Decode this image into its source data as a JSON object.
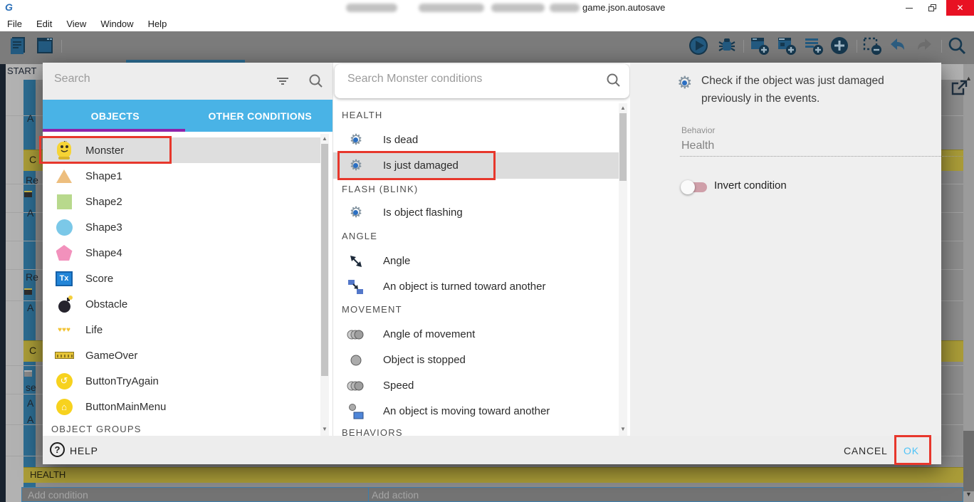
{
  "window": {
    "title_suffix": "game.json.autosave",
    "controls": {
      "close": "✕"
    }
  },
  "menu": {
    "items": [
      "File",
      "Edit",
      "View",
      "Window",
      "Help"
    ]
  },
  "toolbar": {
    "left_icons": [
      "project-manager",
      "scene-window"
    ],
    "right_icons": [
      "play",
      "debug",
      "add-event",
      "add-subevent",
      "add-comment",
      "add-circle",
      "remove-selection",
      "undo",
      "redo",
      "search"
    ]
  },
  "dialog": {
    "left_panel": {
      "search_placeholder": "Search",
      "tabs": [
        {
          "label": "OBJECTS",
          "active": true
        },
        {
          "label": "OTHER CONDITIONS",
          "active": false
        }
      ],
      "objects": [
        {
          "name": "Monster",
          "icon": "monster",
          "selected": true
        },
        {
          "name": "Shape1",
          "icon": "triangle",
          "selected": false
        },
        {
          "name": "Shape2",
          "icon": "square",
          "selected": false
        },
        {
          "name": "Shape3",
          "icon": "circle",
          "selected": false
        },
        {
          "name": "Shape4",
          "icon": "pentagon",
          "selected": false
        },
        {
          "name": "Score",
          "icon": "text-object",
          "selected": false
        },
        {
          "name": "Obstacle",
          "icon": "bomb",
          "selected": false
        },
        {
          "name": "Life",
          "icon": "hearts",
          "selected": false
        },
        {
          "name": "GameOver",
          "icon": "banner",
          "selected": false
        },
        {
          "name": "ButtonTryAgain",
          "icon": "retry-button",
          "selected": false
        },
        {
          "name": "ButtonMainMenu",
          "icon": "home-button",
          "selected": false
        }
      ],
      "score_icon_text": "Tx",
      "hearts_icon_text": "♥♥♥",
      "retry_glyph": "↺",
      "home_glyph": "⌂",
      "groups_header": "OBJECT GROUPS"
    },
    "middle_panel": {
      "search_placeholder": "Search Monster conditions",
      "sections": [
        {
          "header": "HEALTH",
          "items": [
            {
              "label": "Is dead",
              "icon": "gear",
              "selected": false
            },
            {
              "label": "Is just damaged",
              "icon": "gear",
              "selected": true
            }
          ]
        },
        {
          "header": "FLASH (BLINK)",
          "items": [
            {
              "label": "Is object flashing",
              "icon": "gear",
              "selected": false
            }
          ]
        },
        {
          "header": "ANGLE",
          "items": [
            {
              "label": "Angle",
              "icon": "diagonal-arrow",
              "selected": false
            },
            {
              "label": "An object is turned toward another",
              "icon": "squares-arrow",
              "selected": false
            }
          ]
        },
        {
          "header": "MOVEMENT",
          "items": [
            {
              "label": "Angle of movement",
              "icon": "overlap-circles",
              "selected": false
            },
            {
              "label": "Object is stopped",
              "icon": "single-circle",
              "selected": false
            },
            {
              "label": "Speed",
              "icon": "overlap-circles",
              "selected": false
            },
            {
              "label": "An object is moving toward another",
              "icon": "circle-rect",
              "selected": false
            }
          ]
        },
        {
          "header": "BEHAVIORS",
          "items": []
        }
      ],
      "gear_glyph": "⚙"
    },
    "right_panel": {
      "description": "Check if the object was just damaged previously in the events.",
      "behavior_label": "Behavior",
      "behavior_value": "Health",
      "invert_label": "Invert condition",
      "invert_on": false
    },
    "footer": {
      "help": "HELP",
      "cancel": "CANCEL",
      "ok": "OK"
    }
  },
  "background": {
    "start_label": "START",
    "fragments": [
      "A",
      "C",
      "Re",
      "A",
      "Re",
      "A",
      "C",
      "se",
      "A",
      "A"
    ],
    "health_row_label": "HEALTH",
    "add_condition": "Add condition",
    "add_action": "Add action"
  },
  "colors": {
    "accent_blue": "#49b3e6",
    "active_tab_purple": "#8e24aa",
    "annotation_red": "#e7372c",
    "ok_blue": "#4fc3f7",
    "comment_yellow": "#ab9d38",
    "close_red": "#e81123"
  }
}
